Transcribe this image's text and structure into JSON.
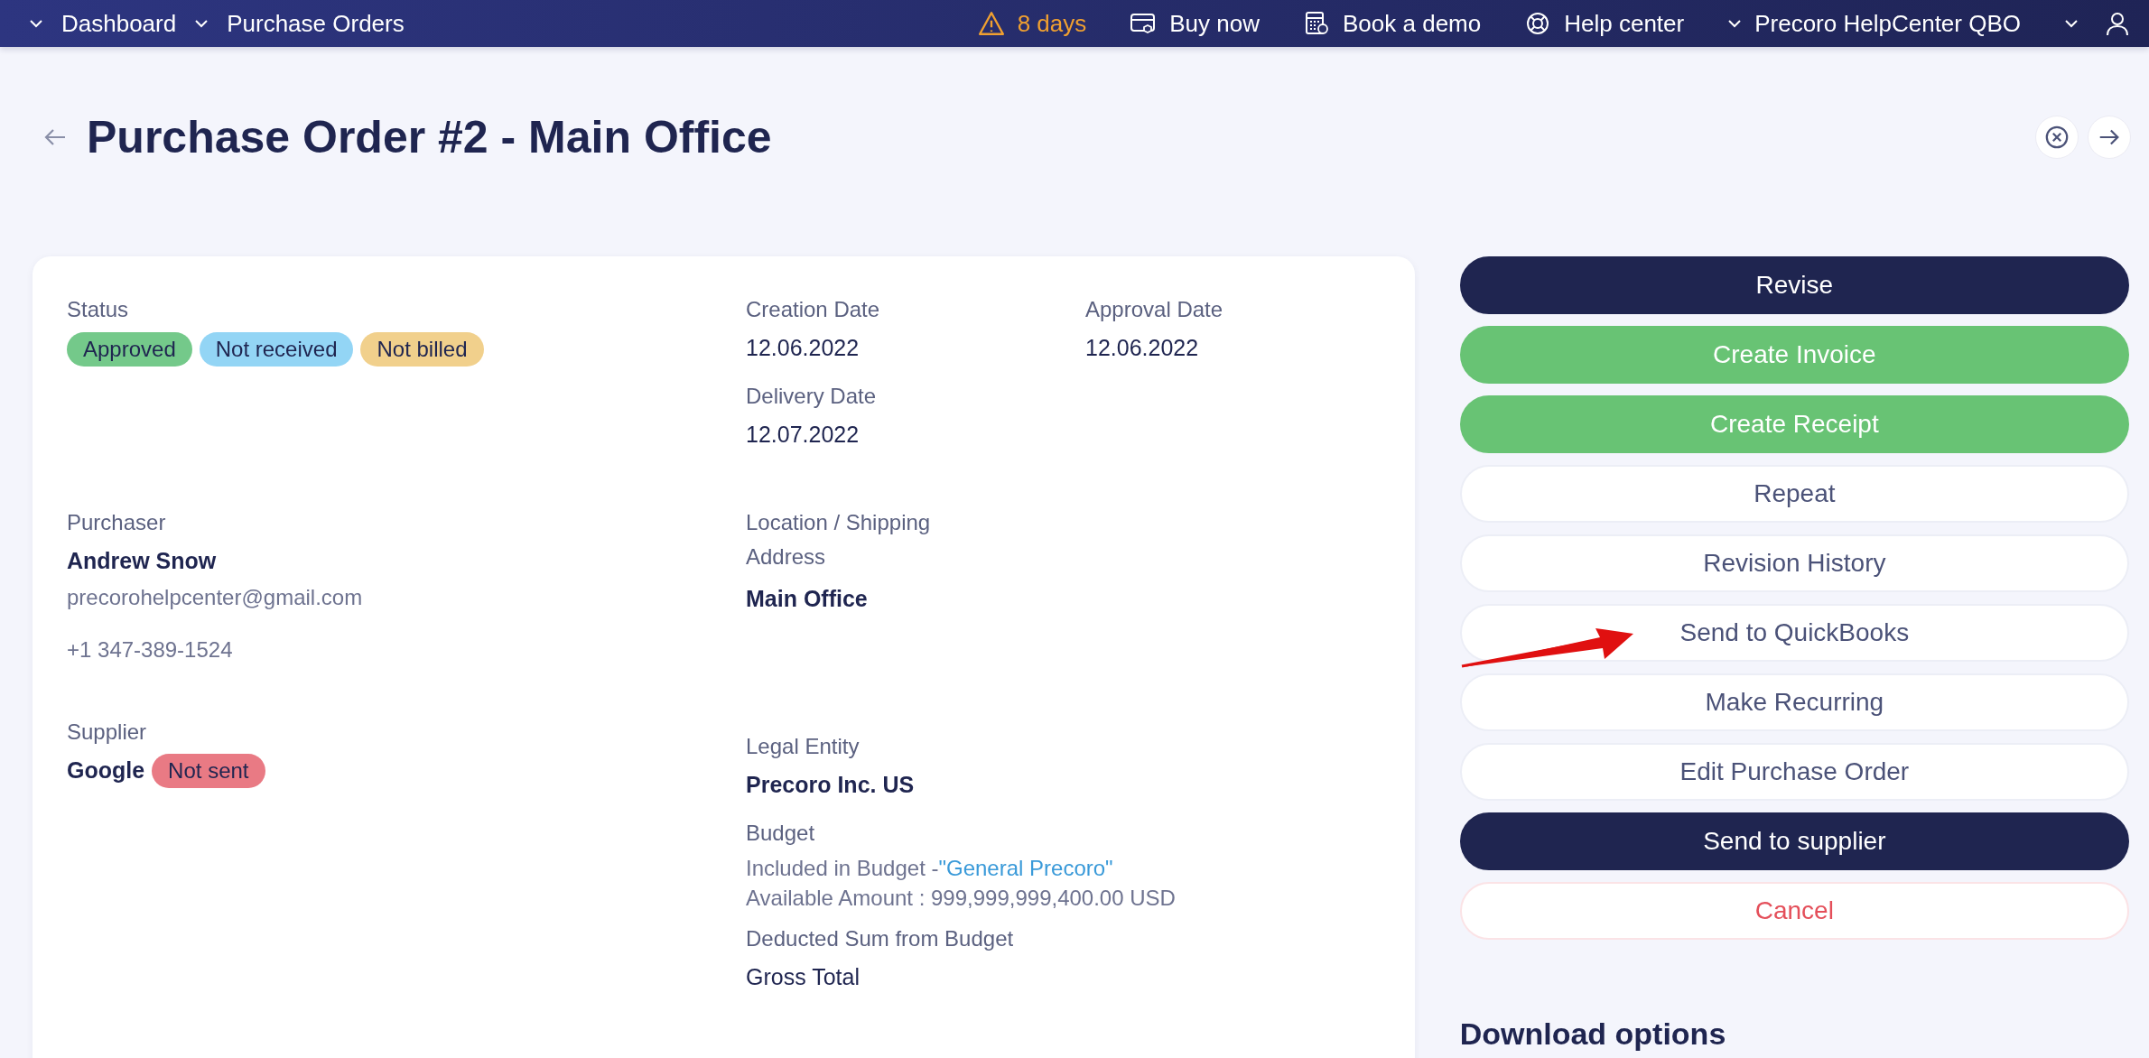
{
  "topbar": {
    "breadcrumbs": [
      "Dashboard",
      "Purchase Orders"
    ],
    "trial": "8 days",
    "links": [
      {
        "label": "Buy now",
        "kind": "card"
      },
      {
        "label": "Book a demo",
        "kind": "calculator"
      },
      {
        "label": "Help center",
        "kind": "lifebuoy"
      }
    ],
    "account": "Precoro HelpCenter QBO"
  },
  "header": {
    "title": "Purchase Order #2 - Main Office"
  },
  "details": {
    "status": {
      "label": "Status",
      "badges": [
        {
          "text": "Approved",
          "color": "#74c98a"
        },
        {
          "text": "Not received",
          "color": "#93d5f5"
        },
        {
          "text": "Not billed",
          "color": "#f1d08c"
        }
      ]
    },
    "creation_date": {
      "label": "Creation Date",
      "value": "12.06.2022"
    },
    "delivery_date": {
      "label": "Delivery Date",
      "value": "12.07.2022"
    },
    "approval_date": {
      "label": "Approval Date",
      "value": "12.06.2022"
    },
    "purchaser": {
      "label": "Purchaser",
      "name": "Andrew Snow",
      "email": "precorohelpcenter@gmail.com",
      "phone": "+1 347-389-1524"
    },
    "location": {
      "label": "Location / Shipping Address",
      "value": "Main Office"
    },
    "supplier": {
      "label": "Supplier",
      "name": "Google",
      "badge": {
        "text": "Not sent",
        "color": "#e97a84"
      }
    },
    "legal_entity": {
      "label": "Legal Entity",
      "value": "Precoro Inc. US"
    },
    "budget": {
      "label": "Budget",
      "included": "Included in Budget - ",
      "link": "\"General Precoro\"",
      "available": "Available Amount : 999,999,999,400.00 USD"
    },
    "deducted": {
      "label": "Deducted Sum from Budget",
      "value": "Gross Total"
    }
  },
  "actions": [
    {
      "label": "Revise",
      "kind": "primary"
    },
    {
      "label": "Create Invoice",
      "kind": "success"
    },
    {
      "label": "Create Receipt",
      "kind": "success"
    },
    {
      "label": "Repeat",
      "kind": "plain"
    },
    {
      "label": "Revision History",
      "kind": "plain"
    },
    {
      "label": "Send to QuickBooks",
      "kind": "plain"
    },
    {
      "label": "Make Recurring",
      "kind": "plain"
    },
    {
      "label": "Edit Purchase Order",
      "kind": "plain"
    },
    {
      "label": "Send to supplier",
      "kind": "primary"
    },
    {
      "label": "Cancel",
      "kind": "danger"
    }
  ],
  "download": {
    "title": "Download options"
  }
}
